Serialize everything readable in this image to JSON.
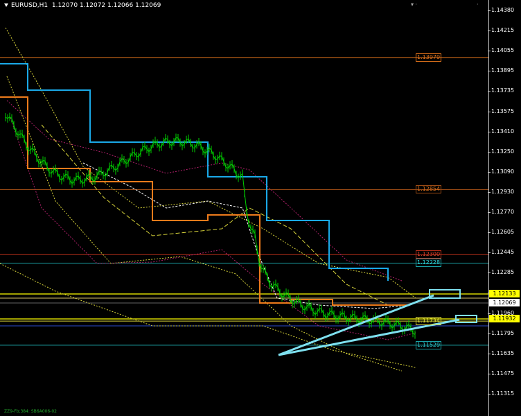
{
  "chart": {
    "symbol_timeframe": "EURUSD,H1",
    "ohlc": "1.12070 1.12072 1.12066 1.12069",
    "footer_text": "ZZ9-Fb;384: SB6A006-02",
    "top_marks": "▾ ·",
    "corner_mark": "·"
  },
  "price_scale": {
    "ticks": [
      "1.14380",
      "1.14215",
      "1.14055",
      "1.13895",
      "1.13735",
      "1.13575",
      "1.13410",
      "1.13250",
      "1.13090",
      "1.12930",
      "1.12770",
      "1.12605",
      "1.12445",
      "1.12285",
      "1.12125",
      "1.11960",
      "1.11795",
      "1.11635",
      "1.11475",
      "1.11315"
    ],
    "current_price": "1.12069",
    "yellow_level_label": "1.12133",
    "lower_yellow_label": "1.11932"
  },
  "levels": [
    {
      "label": "1.13979",
      "price": 1.13979,
      "color": "#e3741c",
      "text_color": "#e3741c"
    },
    {
      "label": "1.12854",
      "price": 1.12854,
      "color": "#9a4a15",
      "text_color": "#e3741c"
    },
    {
      "label": "1.12300",
      "price": 1.123,
      "color": "#b8301b",
      "text_color": "#e0402b"
    },
    {
      "label": "1.12228",
      "price": 1.12228,
      "color": "#1aa3a7",
      "text_color": "#2fd1d6"
    },
    {
      "label": "1.11734",
      "price": 1.11734,
      "color": "#d8d43a",
      "text_color": "#ecec3a"
    },
    {
      "label": "1.11529",
      "price": 1.11529,
      "color": "#1aa3a7",
      "text_color": "#2fd1d6"
    }
  ],
  "colors": {
    "background": "#000000",
    "candle": "#00d000",
    "blue_step": "#1aa9e8",
    "orange_step": "#ee7b1b",
    "arrows": "#7ee0ef",
    "yellow_line": "#ffff00",
    "axis_text": "#ffffff"
  }
}
